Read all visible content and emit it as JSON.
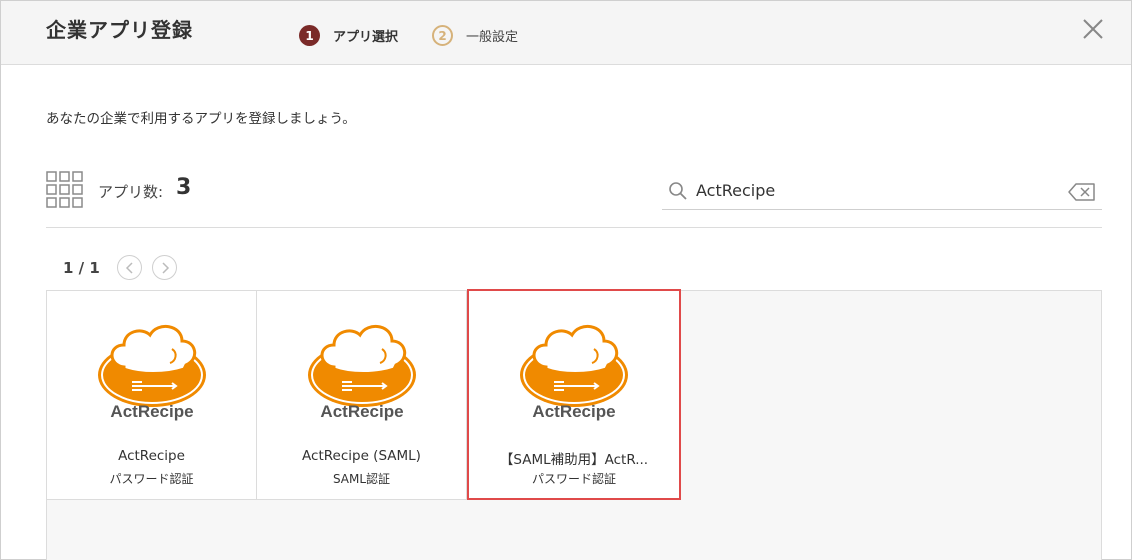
{
  "header": {
    "title": "企業アプリ登録",
    "steps": [
      {
        "num": "1",
        "label": "アプリ選択"
      },
      {
        "num": "2",
        "label": "一般設定"
      }
    ]
  },
  "intro": "あなたの企業で利用するアプリを登録しましょう。",
  "toolbar": {
    "count_label": "アプリ数:",
    "count_value": "3",
    "search_value": "ActRecipe"
  },
  "pager": {
    "text": "1 / 1"
  },
  "apps": [
    {
      "logo_text": "ActRecipe",
      "name": "ActRecipe",
      "auth": "パスワード認証"
    },
    {
      "logo_text": "ActRecipe",
      "name": "ActRecipe (SAML)",
      "auth": "SAML認証"
    },
    {
      "logo_text": "ActRecipe",
      "name": "【SAML補助用】ActR...",
      "auth": "パスワード認証",
      "selected": true
    }
  ],
  "colors": {
    "step_active": "#7a2a28",
    "step_inactive": "#d6b27a",
    "logo_orange": "#f08a00",
    "selected_border": "#e04a4a"
  }
}
